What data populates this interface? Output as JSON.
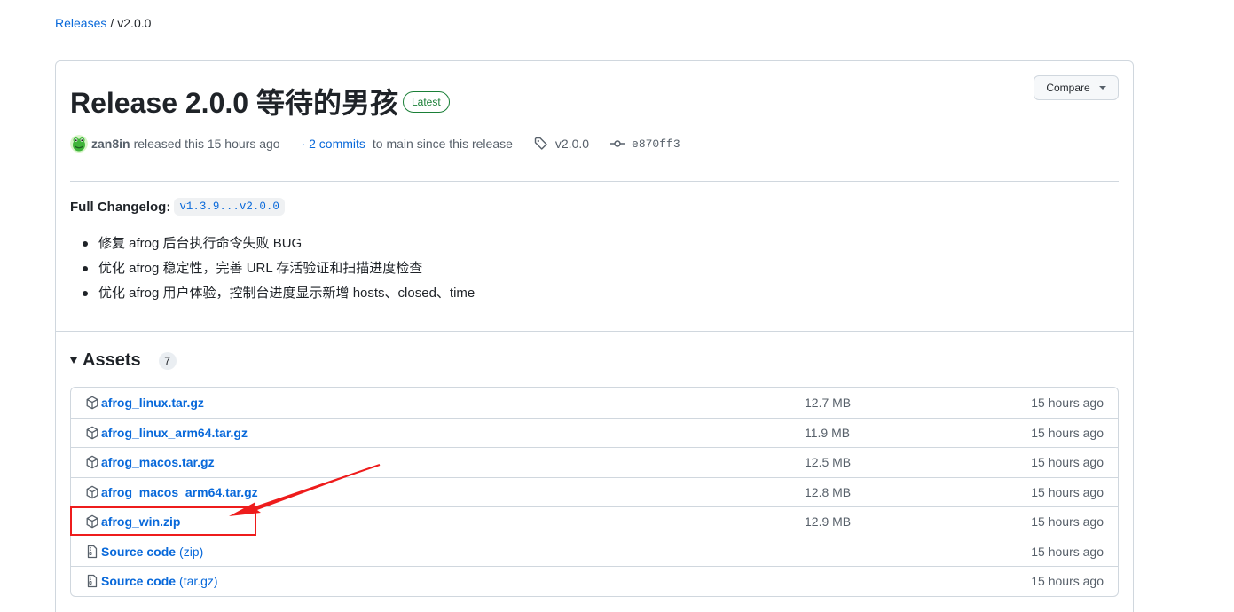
{
  "breadcrumb": {
    "root": "Releases",
    "separator": "/",
    "current": "v2.0.0"
  },
  "release": {
    "title": "Release 2.0.0 等待的男孩",
    "badge": "Latest",
    "compare_label": "Compare",
    "author": "zan8in",
    "released_text": "released this 15 hours ago",
    "commits_link": "· 2 commits",
    "commits_suffix": "to main since this release",
    "tag": "v2.0.0",
    "commit": "e870ff3",
    "changelog_label": "Full Changelog:",
    "changelog_range": "v1.3.9...v2.0.0",
    "notes": [
      "修复 afrog 后台执行命令失败 BUG",
      "优化 afrog 稳定性，完善 URL 存活验证和扫描进度检查",
      "优化 afrog 用户体验，控制台进度显示新增 hosts、closed、time"
    ]
  },
  "assets": {
    "title": "Assets",
    "count": "7",
    "items": [
      {
        "name": "afrog_linux.tar.gz",
        "size": "12.7 MB",
        "time": "15 hours ago",
        "icon": "package-icon"
      },
      {
        "name": "afrog_linux_arm64.tar.gz",
        "size": "11.9 MB",
        "time": "15 hours ago",
        "icon": "package-icon"
      },
      {
        "name": "afrog_macos.tar.gz",
        "size": "12.5 MB",
        "time": "15 hours ago",
        "icon": "package-icon"
      },
      {
        "name": "afrog_macos_arm64.tar.gz",
        "size": "12.8 MB",
        "time": "15 hours ago",
        "icon": "package-icon"
      },
      {
        "name": "afrog_win.zip",
        "size": "12.9 MB",
        "time": "15 hours ago",
        "icon": "package-icon"
      },
      {
        "name": "Source code",
        "suffix": "(zip)",
        "size": "",
        "time": "15 hours ago",
        "icon": "file-zip-icon"
      },
      {
        "name": "Source code",
        "suffix": "(tar.gz)",
        "size": "",
        "time": "15 hours ago",
        "icon": "file-zip-icon"
      }
    ]
  },
  "colors": {
    "link": "#0969da",
    "latest": "#1a7f37",
    "annotation": "#ee1c1c"
  }
}
